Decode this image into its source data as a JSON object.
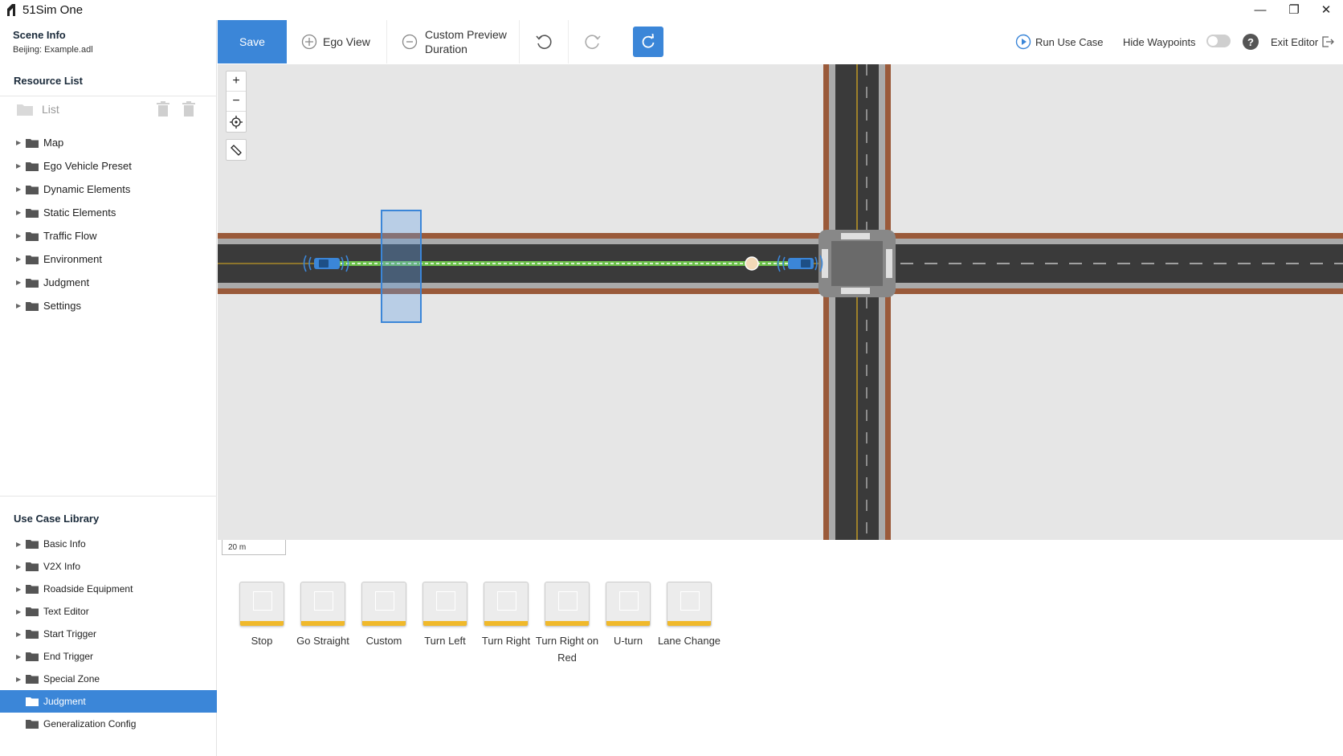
{
  "app": {
    "title": "51Sim One"
  },
  "window_controls": {
    "minimize": "—",
    "maximize": "❐",
    "close": "✕"
  },
  "scene_info": {
    "title": "Scene Info",
    "subtitle": "Beijing: Example.adl"
  },
  "resource_list": {
    "title": "Resource List",
    "toolbar_label": "List",
    "items": [
      {
        "label": "Map"
      },
      {
        "label": "Ego Vehicle Preset"
      },
      {
        "label": "Dynamic Elements"
      },
      {
        "label": "Static Elements"
      },
      {
        "label": "Traffic Flow"
      },
      {
        "label": "Environment"
      },
      {
        "label": "Judgment"
      },
      {
        "label": "Settings"
      }
    ]
  },
  "use_case_library": {
    "title": "Use Case Library",
    "items": [
      {
        "label": "Basic Info",
        "selected": false
      },
      {
        "label": "V2X Info",
        "selected": false
      },
      {
        "label": "Roadside Equipment",
        "selected": false
      },
      {
        "label": "Text Editor",
        "selected": false
      },
      {
        "label": "Start Trigger",
        "selected": false
      },
      {
        "label": "End Trigger",
        "selected": false
      },
      {
        "label": "Special Zone",
        "selected": false
      },
      {
        "label": "Judgment",
        "selected": true
      },
      {
        "label": "Generalization Config",
        "selected": false
      }
    ]
  },
  "toolbar": {
    "save": "Save",
    "ego_view": "Ego View",
    "custom_preview_line1": "Custom Preview",
    "custom_preview_line2": "Duration",
    "run_use_case": "Run Use Case",
    "hide_waypoints": "Hide Waypoints",
    "hide_waypoints_on": false,
    "help": "?",
    "exit_editor": "Exit Editor"
  },
  "map": {
    "zoom_in": "+",
    "zoom_out": "−",
    "scale_label": "20 m"
  },
  "use_case_cards": [
    {
      "label": "Stop"
    },
    {
      "label": "Go Straight"
    },
    {
      "label": "Custom"
    },
    {
      "label": "Turn Left"
    },
    {
      "label": "Turn Right"
    },
    {
      "label": "Turn Right on Red"
    },
    {
      "label": "U-turn"
    },
    {
      "label": "Lane Change"
    }
  ],
  "colors": {
    "accent": "#3b86d8",
    "road": "#3a3a3a",
    "curb": "#a0522d",
    "route": "#6cc04a",
    "card_bar": "#f0b92b"
  }
}
